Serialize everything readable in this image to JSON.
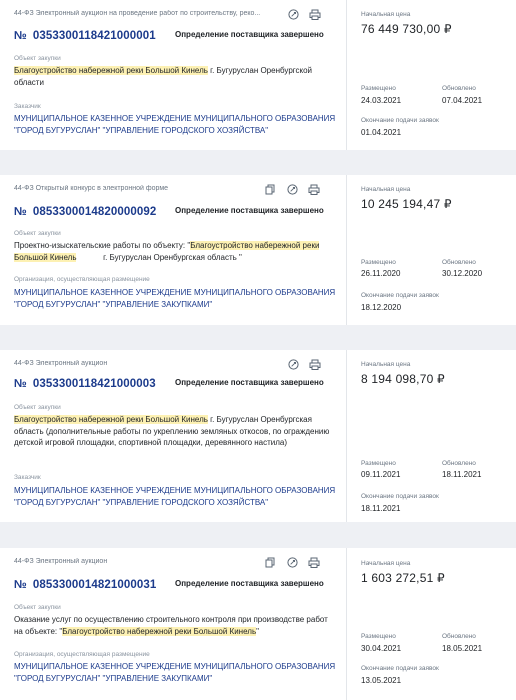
{
  "labels": {
    "object": "Объект закупки",
    "customer": "Заказчик",
    "organizer": "Организация, осуществляющая размещение",
    "initial_price": "Начальная цена",
    "posted": "Размещено",
    "updated": "Обновлено",
    "deadline": "Окончание подачи заявок"
  },
  "cards": [
    {
      "law": "44-ФЗ Электронный аукцион на проведение работ по строительству, реко...",
      "number_sign": "№",
      "number": "0353300118421000001",
      "status": "Определение поставщика завершено",
      "object_pre": "",
      "object_hl": "Благоустройство набережной реки Большой Кинель",
      "object_post": " г. Бугуруслан Оренбургской области",
      "org_label_key": "customer",
      "org": "МУНИЦИПАЛЬНОЕ КАЗЕННОЕ УЧРЕЖДЕНИЕ МУНИЦИПАЛЬНОГО ОБРАЗОВАНИЯ \"ГОРОД БУГУРУСЛАН\" \"УПРАВЛЕНИЕ ГОРОДСКОГО ХОЗЯЙСТВА\"",
      "price": "76 449 730,00 ₽",
      "posted": "24.03.2021",
      "updated": "07.04.2021",
      "deadline": "01.04.2021",
      "icons": [
        "sign-icon",
        "print-icon"
      ]
    },
    {
      "law": "44-ФЗ Открытый конкурс в электронной форме",
      "number_sign": "№",
      "number": "0853300014820000092",
      "status": "Определение поставщика завершено",
      "object_pre": "Проектно-изыскательские работы по объекту: \"",
      "object_hl": "Благоустройство набережной реки Большой Кинель",
      "object_post": "            г. Бугуруслан Оренбургская область \"",
      "org_label_key": "organizer",
      "org": "МУНИЦИПАЛЬНОЕ КАЗЕННОЕ УЧРЕЖДЕНИЕ МУНИЦИПАЛЬНОГО ОБРАЗОВАНИЯ \"ГОРОД БУГУРУСЛАН\" \"УПРАВЛЕНИЕ ЗАКУПКАМИ\"",
      "price": "10 245 194,47 ₽",
      "posted": "26.11.2020",
      "updated": "30.12.2020",
      "deadline": "18.12.2020",
      "icons": [
        "copy-icon",
        "sign-icon",
        "print-icon"
      ]
    },
    {
      "law": "44-ФЗ Электронный аукцион",
      "number_sign": "№",
      "number": "0353300118421000003",
      "status": "Определение поставщика завершено",
      "object_pre": "",
      "object_hl": "Благоустройство набережной реки Большой Кинель",
      "object_post": " г. Бугуруслан Оренбургская область (дополнительные работы по укреплению земляных откосов, по ограждению детской игровой площадки, спортивной площадки, деревянного настила)",
      "org_label_key": "customer",
      "org": "МУНИЦИПАЛЬНОЕ КАЗЕННОЕ УЧРЕЖДЕНИЕ МУНИЦИПАЛЬНОГО ОБРАЗОВАНИЯ \"ГОРОД БУГУРУСЛАН\" \"УПРАВЛЕНИЕ ГОРОДСКОГО ХОЗЯЙСТВА\"",
      "price": "8 194 098,70 ₽",
      "posted": "09.11.2021",
      "updated": "18.11.2021",
      "deadline": "18.11.2021",
      "icons": [
        "sign-icon",
        "print-icon"
      ]
    },
    {
      "law": "44-ФЗ Электронный аукцион",
      "number_sign": "№",
      "number": "0853300014821000031",
      "status": "Определение поставщика завершено",
      "object_pre": "Оказание услуг по осуществлению строительного контроля при производстве работ на объекте: \"",
      "object_hl": "Благоустройство набережной реки Большой Кинель",
      "object_post": "\"",
      "org_label_key": "organizer",
      "org": "МУНИЦИПАЛЬНОЕ КАЗЕННОЕ УЧРЕЖДЕНИЕ МУНИЦИПАЛЬНОГО ОБРАЗОВАНИЯ \"ГОРОД БУГУРУСЛАН\" \"УПРАВЛЕНИЕ ЗАКУПКАМИ\"",
      "price": "1 603 272,51 ₽",
      "posted": "30.04.2021",
      "updated": "18.05.2021",
      "deadline": "13.05.2021",
      "icons": [
        "copy-icon",
        "sign-icon",
        "print-icon"
      ]
    }
  ]
}
